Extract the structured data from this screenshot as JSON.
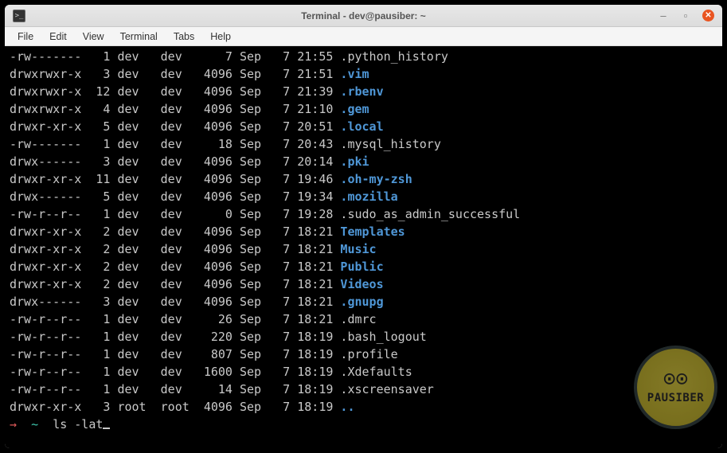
{
  "window": {
    "title": "Terminal - dev@pausiber: ~"
  },
  "menubar": [
    "File",
    "Edit",
    "View",
    "Terminal",
    "Tabs",
    "Help"
  ],
  "logo_text": "PAUSIBER",
  "prompt": {
    "arrow": "→",
    "tilde": "~",
    "command": "ls -lat"
  },
  "listing": [
    {
      "perm": "-rw-------",
      "links": "1",
      "owner": "dev",
      "group": "dev",
      "size": "7",
      "month": "Sep",
      "day": "7",
      "time": "21:55",
      "name": ".python_history",
      "type": "file"
    },
    {
      "perm": "drwxrwxr-x",
      "links": "3",
      "owner": "dev",
      "group": "dev",
      "size": "4096",
      "month": "Sep",
      "day": "7",
      "time": "21:51",
      "name": ".vim",
      "type": "dir"
    },
    {
      "perm": "drwxrwxr-x",
      "links": "12",
      "owner": "dev",
      "group": "dev",
      "size": "4096",
      "month": "Sep",
      "day": "7",
      "time": "21:39",
      "name": ".rbenv",
      "type": "dir"
    },
    {
      "perm": "drwxrwxr-x",
      "links": "4",
      "owner": "dev",
      "group": "dev",
      "size": "4096",
      "month": "Sep",
      "day": "7",
      "time": "21:10",
      "name": ".gem",
      "type": "dir"
    },
    {
      "perm": "drwxr-xr-x",
      "links": "5",
      "owner": "dev",
      "group": "dev",
      "size": "4096",
      "month": "Sep",
      "day": "7",
      "time": "20:51",
      "name": ".local",
      "type": "dir"
    },
    {
      "perm": "-rw-------",
      "links": "1",
      "owner": "dev",
      "group": "dev",
      "size": "18",
      "month": "Sep",
      "day": "7",
      "time": "20:43",
      "name": ".mysql_history",
      "type": "file"
    },
    {
      "perm": "drwx------",
      "links": "3",
      "owner": "dev",
      "group": "dev",
      "size": "4096",
      "month": "Sep",
      "day": "7",
      "time": "20:14",
      "name": ".pki",
      "type": "dir"
    },
    {
      "perm": "drwxr-xr-x",
      "links": "11",
      "owner": "dev",
      "group": "dev",
      "size": "4096",
      "month": "Sep",
      "day": "7",
      "time": "19:46",
      "name": ".oh-my-zsh",
      "type": "dir"
    },
    {
      "perm": "drwx------",
      "links": "5",
      "owner": "dev",
      "group": "dev",
      "size": "4096",
      "month": "Sep",
      "day": "7",
      "time": "19:34",
      "name": ".mozilla",
      "type": "dir"
    },
    {
      "perm": "-rw-r--r--",
      "links": "1",
      "owner": "dev",
      "group": "dev",
      "size": "0",
      "month": "Sep",
      "day": "7",
      "time": "19:28",
      "name": ".sudo_as_admin_successful",
      "type": "file"
    },
    {
      "perm": "drwxr-xr-x",
      "links": "2",
      "owner": "dev",
      "group": "dev",
      "size": "4096",
      "month": "Sep",
      "day": "7",
      "time": "18:21",
      "name": "Templates",
      "type": "dir"
    },
    {
      "perm": "drwxr-xr-x",
      "links": "2",
      "owner": "dev",
      "group": "dev",
      "size": "4096",
      "month": "Sep",
      "day": "7",
      "time": "18:21",
      "name": "Music",
      "type": "dir"
    },
    {
      "perm": "drwxr-xr-x",
      "links": "2",
      "owner": "dev",
      "group": "dev",
      "size": "4096",
      "month": "Sep",
      "day": "7",
      "time": "18:21",
      "name": "Public",
      "type": "dir"
    },
    {
      "perm": "drwxr-xr-x",
      "links": "2",
      "owner": "dev",
      "group": "dev",
      "size": "4096",
      "month": "Sep",
      "day": "7",
      "time": "18:21",
      "name": "Videos",
      "type": "dir"
    },
    {
      "perm": "drwx------",
      "links": "3",
      "owner": "dev",
      "group": "dev",
      "size": "4096",
      "month": "Sep",
      "day": "7",
      "time": "18:21",
      "name": ".gnupg",
      "type": "dir"
    },
    {
      "perm": "-rw-r--r--",
      "links": "1",
      "owner": "dev",
      "group": "dev",
      "size": "26",
      "month": "Sep",
      "day": "7",
      "time": "18:21",
      "name": ".dmrc",
      "type": "file"
    },
    {
      "perm": "-rw-r--r--",
      "links": "1",
      "owner": "dev",
      "group": "dev",
      "size": "220",
      "month": "Sep",
      "day": "7",
      "time": "18:19",
      "name": ".bash_logout",
      "type": "file"
    },
    {
      "perm": "-rw-r--r--",
      "links": "1",
      "owner": "dev",
      "group": "dev",
      "size": "807",
      "month": "Sep",
      "day": "7",
      "time": "18:19",
      "name": ".profile",
      "type": "file"
    },
    {
      "perm": "-rw-r--r--",
      "links": "1",
      "owner": "dev",
      "group": "dev",
      "size": "1600",
      "month": "Sep",
      "day": "7",
      "time": "18:19",
      "name": ".Xdefaults",
      "type": "file"
    },
    {
      "perm": "-rw-r--r--",
      "links": "1",
      "owner": "dev",
      "group": "dev",
      "size": "14",
      "month": "Sep",
      "day": "7",
      "time": "18:19",
      "name": ".xscreensaver",
      "type": "file"
    },
    {
      "perm": "drwxr-xr-x",
      "links": "3",
      "owner": "root",
      "group": "root",
      "size": "4096",
      "month": "Sep",
      "day": "7",
      "time": "18:19",
      "name": "..",
      "type": "dir"
    }
  ]
}
